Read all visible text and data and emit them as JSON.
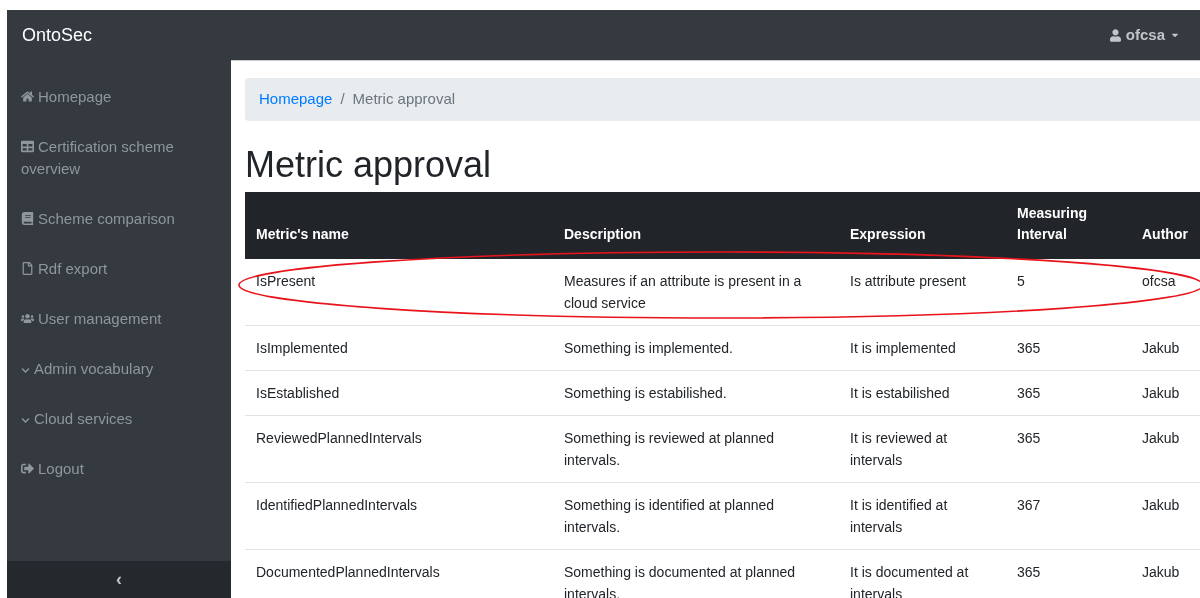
{
  "navbar": {
    "brand": "OntoSec",
    "user": "ofcsa"
  },
  "sidebar": {
    "items": [
      {
        "label": "Homepage",
        "kind": "link"
      },
      {
        "label": "Certification scheme overview",
        "kind": "link"
      },
      {
        "label": "Scheme comparison",
        "kind": "link"
      },
      {
        "label": "Rdf export",
        "kind": "link"
      },
      {
        "label": "User management",
        "kind": "link"
      },
      {
        "label": "Admin vocabulary",
        "kind": "group"
      },
      {
        "label": "Cloud services",
        "kind": "group"
      },
      {
        "label": "Logout",
        "kind": "link"
      }
    ],
    "collapse_toggle": "‹"
  },
  "breadcrumb_separator": "/",
  "breadcrumb": [
    {
      "label": "Homepage",
      "kind": "link"
    },
    {
      "label": "Metric approval",
      "kind": "current"
    }
  ],
  "title": "Metric approval",
  "table": {
    "columns": [
      "Metric's name",
      "Description",
      "Expression",
      "Measuring Interval",
      "Author"
    ],
    "rows": [
      {
        "cells": [
          "IsPresent",
          "Measures if an attribute is present in a cloud service",
          "Is attribute present",
          "5",
          "ofcsa"
        ],
        "highlighted": true
      },
      {
        "cells": [
          "IsImplemented",
          "Something is implemented.",
          "It is implemented",
          "365",
          "Jakub"
        ],
        "highlighted": false
      },
      {
        "cells": [
          "IsEstablished",
          "Something is estabilished.",
          "It is estabilished",
          "365",
          "Jakub"
        ],
        "highlighted": false
      },
      {
        "cells": [
          "ReviewedPlannedIntervals",
          "Something is reviewed at planned intervals.",
          "It is reviewed at intervals",
          "365",
          "Jakub"
        ],
        "highlighted": false
      },
      {
        "cells": [
          "IdentifiedPlannedIntervals",
          "Something is identified at planned intervals.",
          "It is identified at intervals",
          "367",
          "Jakub"
        ],
        "highlighted": false
      },
      {
        "cells": [
          "DocumentedPlannedIntervals",
          "Something is documented at planned intervals.",
          "It is documented at intervals",
          "365",
          "Jakub"
        ],
        "highlighted": false
      }
    ]
  }
}
